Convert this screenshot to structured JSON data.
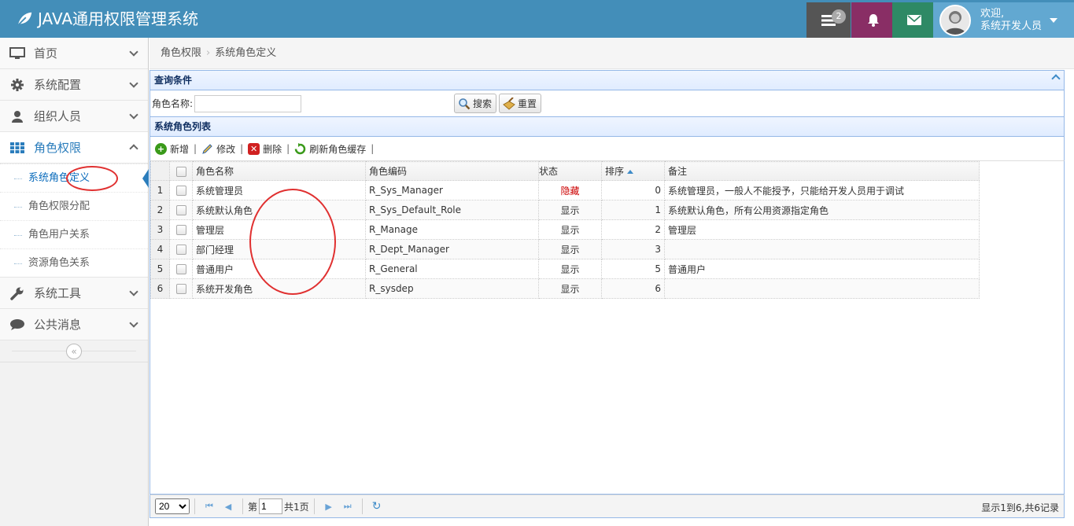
{
  "app": {
    "title": "JAVA通用权限管理系统"
  },
  "header": {
    "task_count": "2",
    "user_greeting": "欢迎,",
    "user_name": "系统开发人员",
    "colors": {
      "bar": "#438eb9",
      "tasks": "#555555",
      "bell": "#892e65",
      "mail": "#2e8965",
      "user": "#62a8d1"
    }
  },
  "sidebar": {
    "items": [
      {
        "label": "首页",
        "icon": "desktop-icon"
      },
      {
        "label": "系统配置",
        "icon": "gear-icon"
      },
      {
        "label": "组织人员",
        "icon": "user-icon"
      },
      {
        "label": "角色权限",
        "icon": "grid-icon",
        "expanded": true
      },
      {
        "label": "系统工具",
        "icon": "wrench-icon"
      },
      {
        "label": "公共消息",
        "icon": "comment-icon"
      }
    ],
    "submenu": [
      {
        "label": "系统角色定义",
        "active": true
      },
      {
        "label": "角色权限分配"
      },
      {
        "label": "角色用户关系"
      },
      {
        "label": "资源角色关系"
      }
    ],
    "collapse_glyph": "«"
  },
  "breadcrumb": {
    "parent": "角色权限",
    "current": "系统角色定义"
  },
  "query": {
    "title": "查询条件",
    "role_name_label": "角色名称:",
    "role_name_value": "",
    "search_label": "搜索",
    "reset_label": "重置"
  },
  "list": {
    "title": "系统角色列表",
    "toolbar": {
      "add": "新增",
      "edit": "修改",
      "delete": "删除",
      "refresh": "刷新角色缓存"
    },
    "columns": {
      "name": "角色名称",
      "code": "角色编码",
      "status": "状态",
      "sort": "排序",
      "remark": "备注"
    },
    "rows": [
      {
        "num": "1",
        "name": "系统管理员",
        "code": "R_Sys_Manager",
        "status": "隐藏",
        "sort": "0",
        "remark": "系统管理员，一般人不能授予，只能给开发人员用于调试"
      },
      {
        "num": "2",
        "name": "系统默认角色",
        "code": "R_Sys_Default_Role",
        "status": "显示",
        "sort": "1",
        "remark": "系统默认角色，所有公用资源指定角色"
      },
      {
        "num": "3",
        "name": "管理层",
        "code": "R_Manage",
        "status": "显示",
        "sort": "2",
        "remark": "管理层"
      },
      {
        "num": "4",
        "name": "部门经理",
        "code": "R_Dept_Manager",
        "status": "显示",
        "sort": "3",
        "remark": ""
      },
      {
        "num": "5",
        "name": "普通用户",
        "code": "R_General",
        "status": "显示",
        "sort": "5",
        "remark": "普通用户"
      },
      {
        "num": "6",
        "name": "系统开发角色",
        "code": "R_sysdep",
        "status": "显示",
        "sort": "6",
        "remark": ""
      }
    ]
  },
  "pager": {
    "page_size": "20",
    "page_prefix": "第",
    "page_value": "1",
    "total_pages": "共1页",
    "info": "显示1到6,共6记录"
  }
}
